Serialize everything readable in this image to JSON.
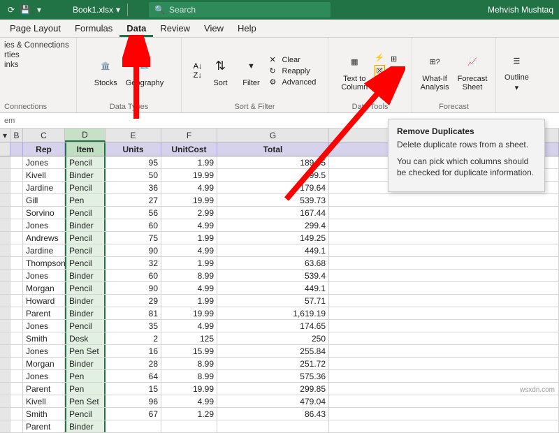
{
  "titlebar": {
    "filename": "Book1.xlsx",
    "search_placeholder": "Search",
    "username": "Mehvish Mushtaq"
  },
  "tabs": [
    "Page Layout",
    "Formulas",
    "Data",
    "Review",
    "View",
    "Help"
  ],
  "active_tab": "Data",
  "ribbon": {
    "connections": {
      "lines": [
        "ies & Connections",
        "rties",
        "inks"
      ],
      "label": "Connections"
    },
    "datatypes": {
      "stocks": "Stocks",
      "geography": "Geography",
      "label": "Data Types"
    },
    "sortfilter": {
      "sort": "Sort",
      "filter": "Filter",
      "clear": "Clear",
      "reapply": "Reapply",
      "advanced": "Advanced",
      "label": "Sort & Filter"
    },
    "datatools": {
      "textcol": "Text to\nColumn",
      "label": "Data Tools"
    },
    "forecast": {
      "whatif": "What-If\nAnalysis",
      "sheet": "Forecast\nSheet",
      "label": "Forecast"
    },
    "outline": {
      "btn": "Outline"
    }
  },
  "namebox": "em",
  "columns": [
    "B",
    "C",
    "D",
    "E",
    "F",
    "G"
  ],
  "headers": {
    "C": "Rep",
    "D": "Item",
    "E": "Units",
    "F": "UnitCost",
    "G": "Total"
  },
  "rows": [
    {
      "C": "Jones",
      "D": "Pencil",
      "E": "95",
      "F": "1.99",
      "G": "189.05"
    },
    {
      "C": "Kivell",
      "D": "Binder",
      "E": "50",
      "F": "19.99",
      "G": "999.5"
    },
    {
      "C": "Jardine",
      "D": "Pencil",
      "E": "36",
      "F": "4.99",
      "G": "179.64"
    },
    {
      "C": "Gill",
      "D": "Pen",
      "E": "27",
      "F": "19.99",
      "G": "539.73"
    },
    {
      "C": "Sorvino",
      "D": "Pencil",
      "E": "56",
      "F": "2.99",
      "G": "167.44"
    },
    {
      "C": "Jones",
      "D": "Binder",
      "E": "60",
      "F": "4.99",
      "G": "299.4"
    },
    {
      "C": "Andrews",
      "D": "Pencil",
      "E": "75",
      "F": "1.99",
      "G": "149.25"
    },
    {
      "C": "Jardine",
      "D": "Pencil",
      "E": "90",
      "F": "4.99",
      "G": "449.1"
    },
    {
      "C": "Thompson",
      "D": "Pencil",
      "E": "32",
      "F": "1.99",
      "G": "63.68"
    },
    {
      "C": "Jones",
      "D": "Binder",
      "E": "60",
      "F": "8.99",
      "G": "539.4"
    },
    {
      "C": "Morgan",
      "D": "Pencil",
      "E": "90",
      "F": "4.99",
      "G": "449.1"
    },
    {
      "C": "Howard",
      "D": "Binder",
      "E": "29",
      "F": "1.99",
      "G": "57.71"
    },
    {
      "C": "Parent",
      "D": "Binder",
      "E": "81",
      "F": "19.99",
      "G": "1,619.19"
    },
    {
      "C": "Jones",
      "D": "Pencil",
      "E": "35",
      "F": "4.99",
      "G": "174.65"
    },
    {
      "C": "Smith",
      "D": "Desk",
      "E": "2",
      "F": "125",
      "G": "250"
    },
    {
      "C": "Jones",
      "D": "Pen Set",
      "E": "16",
      "F": "15.99",
      "G": "255.84"
    },
    {
      "C": "Morgan",
      "D": "Binder",
      "E": "28",
      "F": "8.99",
      "G": "251.72"
    },
    {
      "C": "Jones",
      "D": "Pen",
      "E": "64",
      "F": "8.99",
      "G": "575.36"
    },
    {
      "C": "Parent",
      "D": "Pen",
      "E": "15",
      "F": "19.99",
      "G": "299.85"
    },
    {
      "C": "Kivell",
      "D": "Pen Set",
      "E": "96",
      "F": "4.99",
      "G": "479.04"
    },
    {
      "C": "Smith",
      "D": "Pencil",
      "E": "67",
      "F": "1.29",
      "G": "86.43"
    },
    {
      "C": "Parent",
      "D": "Binder",
      "E": "",
      "F": "",
      "G": ""
    }
  ],
  "tooltip": {
    "title": "Remove Duplicates",
    "line1": "Delete duplicate rows from a sheet.",
    "line2": "You can pick which columns should be checked for duplicate information."
  },
  "watermark": "wsxdn.com"
}
